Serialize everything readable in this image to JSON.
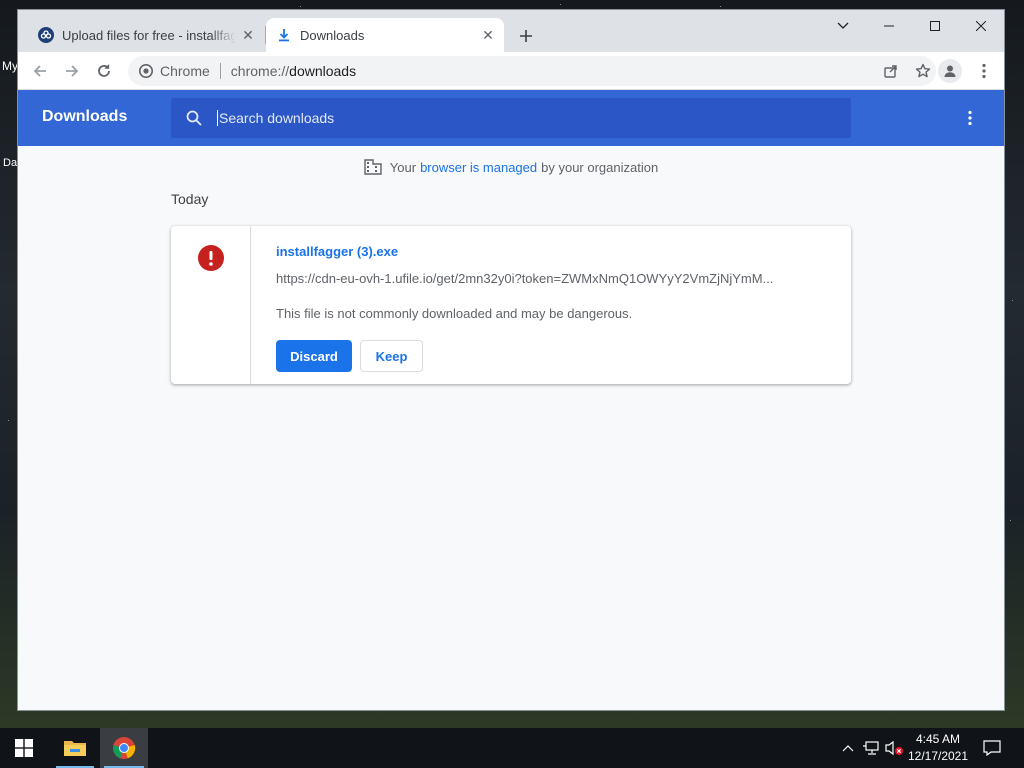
{
  "desktop": {
    "fragment1": "My",
    "fragment2": "Da"
  },
  "browser": {
    "tabs": [
      {
        "title": "Upload files for free - installfagger",
        "favicon": "ufile-logo-icon",
        "active": false
      },
      {
        "title": "Downloads",
        "favicon": "download-icon",
        "active": true
      }
    ],
    "window_controls": [
      "chevron-down-icon",
      "minimize-icon",
      "maximize-icon",
      "close-icon"
    ],
    "omnibox": {
      "chip": "Chrome",
      "scheme": "chrome://",
      "host": "downloads"
    }
  },
  "downloads_page": {
    "title": "Downloads",
    "search_placeholder": "Search downloads",
    "managed_prefix": "Your",
    "managed_link": "browser is managed",
    "managed_suffix": "by your organization",
    "date_header": "Today",
    "items": [
      {
        "filename": "installfagger (3).exe",
        "url": "https://cdn-eu-ovh-1.ufile.io/get/2mn32y0i?token=ZWMxNmQ1OWYyY2VmZjNjYmM...",
        "warning": "This file is not commonly downloaded and may be dangerous.",
        "discard_label": "Discard",
        "keep_label": "Keep"
      }
    ]
  },
  "taskbar": {
    "time": "4:45 AM",
    "date": "12/17/2021"
  },
  "colors": {
    "header_blue": "#3367d6",
    "link_blue": "#1a73e8",
    "error_red": "#c5221f"
  }
}
